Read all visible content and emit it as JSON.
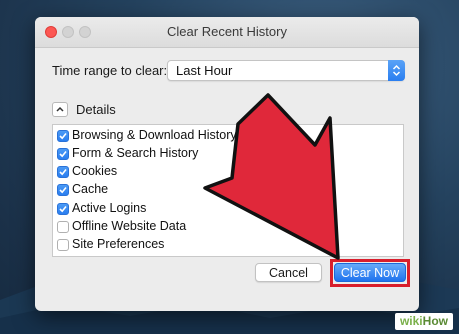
{
  "dialog": {
    "title": "Clear Recent History",
    "time_range_label": "Time range to clear:",
    "time_range_value": "Last Hour",
    "details_label": "Details",
    "items": [
      {
        "label": "Browsing & Download History",
        "checked": true
      },
      {
        "label": "Form & Search History",
        "checked": true
      },
      {
        "label": "Cookies",
        "checked": true
      },
      {
        "label": "Cache",
        "checked": true
      },
      {
        "label": "Active Logins",
        "checked": true
      },
      {
        "label": "Offline Website Data",
        "checked": false
      },
      {
        "label": "Site Preferences",
        "checked": false
      }
    ],
    "cancel_label": "Cancel",
    "clear_label": "Clear Now"
  },
  "colors": {
    "accent": "#2a7ef0",
    "highlight": "#d81e2c",
    "arrow": "#e0283a"
  },
  "watermark": {
    "brand": "wiki",
    "suffix": "How"
  }
}
